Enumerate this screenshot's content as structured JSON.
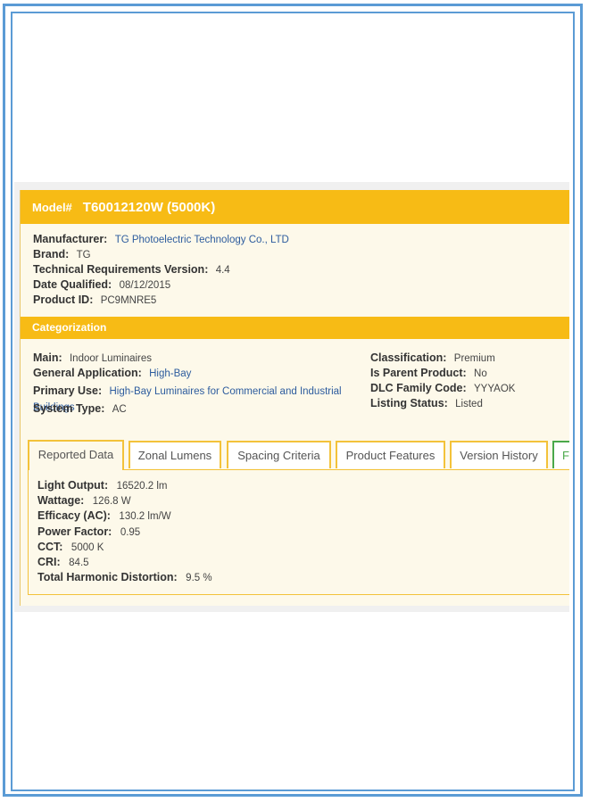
{
  "model": {
    "label": "Model#",
    "value": "T60012120W (5000K)"
  },
  "info": [
    {
      "label": "Manufacturer:",
      "value": "TG Photoelectric Technology Co., LTD",
      "link": true
    },
    {
      "label": "Brand:",
      "value": "TG",
      "link": false
    },
    {
      "label": "Technical Requirements Version:",
      "value": "4.4",
      "link": false
    },
    {
      "label": "Date Qualified:",
      "value": "08/12/2015",
      "link": false
    },
    {
      "label": "Product ID:",
      "value": "PC9MNRE5",
      "link": false
    }
  ],
  "categorization": {
    "title": "Categorization",
    "left": [
      {
        "label": "Main:",
        "value": "Indoor Luminaires",
        "link": false
      },
      {
        "label": "General Application:",
        "value": "High-Bay",
        "link": true
      },
      {
        "label": "Primary Use:",
        "value": "High-Bay Luminaires for Commercial and Industrial Buildings",
        "link": true
      },
      {
        "label": "System Type:",
        "value": "AC",
        "link": false
      }
    ],
    "right": [
      {
        "label": "Classification:",
        "value": "Premium"
      },
      {
        "label": "Is Parent Product:",
        "value": "No"
      },
      {
        "label": "DLC Family Code:",
        "value": "YYYAOK"
      },
      {
        "label": "Listing Status:",
        "value": "Listed"
      }
    ]
  },
  "tabs": [
    "Reported Data",
    "Zonal Lumens",
    "Spacing Criteria",
    "Product Features",
    "Version History",
    "F"
  ],
  "active_tab": "Reported Data",
  "reported_data": [
    {
      "label": "Light Output:",
      "value": "16520.2 lm"
    },
    {
      "label": "Wattage:",
      "value": "126.8 W"
    },
    {
      "label": "Efficacy (AC):",
      "value": "130.2 lm/W"
    },
    {
      "label": "Power Factor:",
      "value": "0.95"
    },
    {
      "label": "CCT:",
      "value": "5000 K"
    },
    {
      "label": "CRI:",
      "value": "84.5"
    },
    {
      "label": "Total Harmonic Distortion:",
      "value": "9.5 %"
    }
  ],
  "colors": {
    "accent": "#f7bb15",
    "link": "#2d5c9e",
    "frame": "#5b9bd5",
    "tab_border": "#f3c23a",
    "tab_green": "#4aa84a"
  }
}
